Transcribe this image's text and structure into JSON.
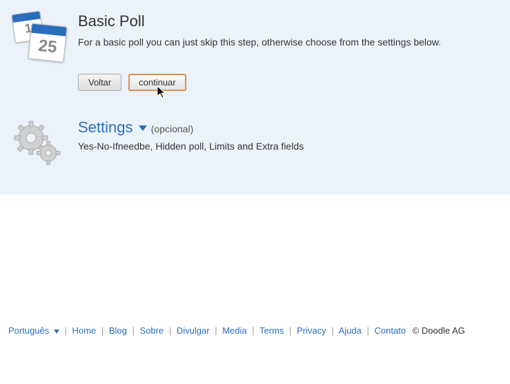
{
  "basic_poll": {
    "title": "Basic Poll",
    "description": "For a basic poll you can just skip this step, otherwise choose from the settings below.",
    "back_button": "Voltar",
    "continue_button": "continuar",
    "cal_back_num": "1",
    "cal_front_num": "25"
  },
  "settings": {
    "title": "Settings",
    "optional": "(opcional)",
    "description": "Yes-No-Ifneedbe, Hidden poll, Limits and Extra fields"
  },
  "footer": {
    "language": "Português",
    "links": {
      "home": "Home",
      "blog": "Blog",
      "sobre": "Sobre",
      "divulgar": "Divulgar",
      "media": "Media",
      "terms": "Terms",
      "privacy": "Privacy",
      "ajuda": "Ajuda",
      "contato": "Contato"
    },
    "copyright": "© Doodle AG"
  }
}
